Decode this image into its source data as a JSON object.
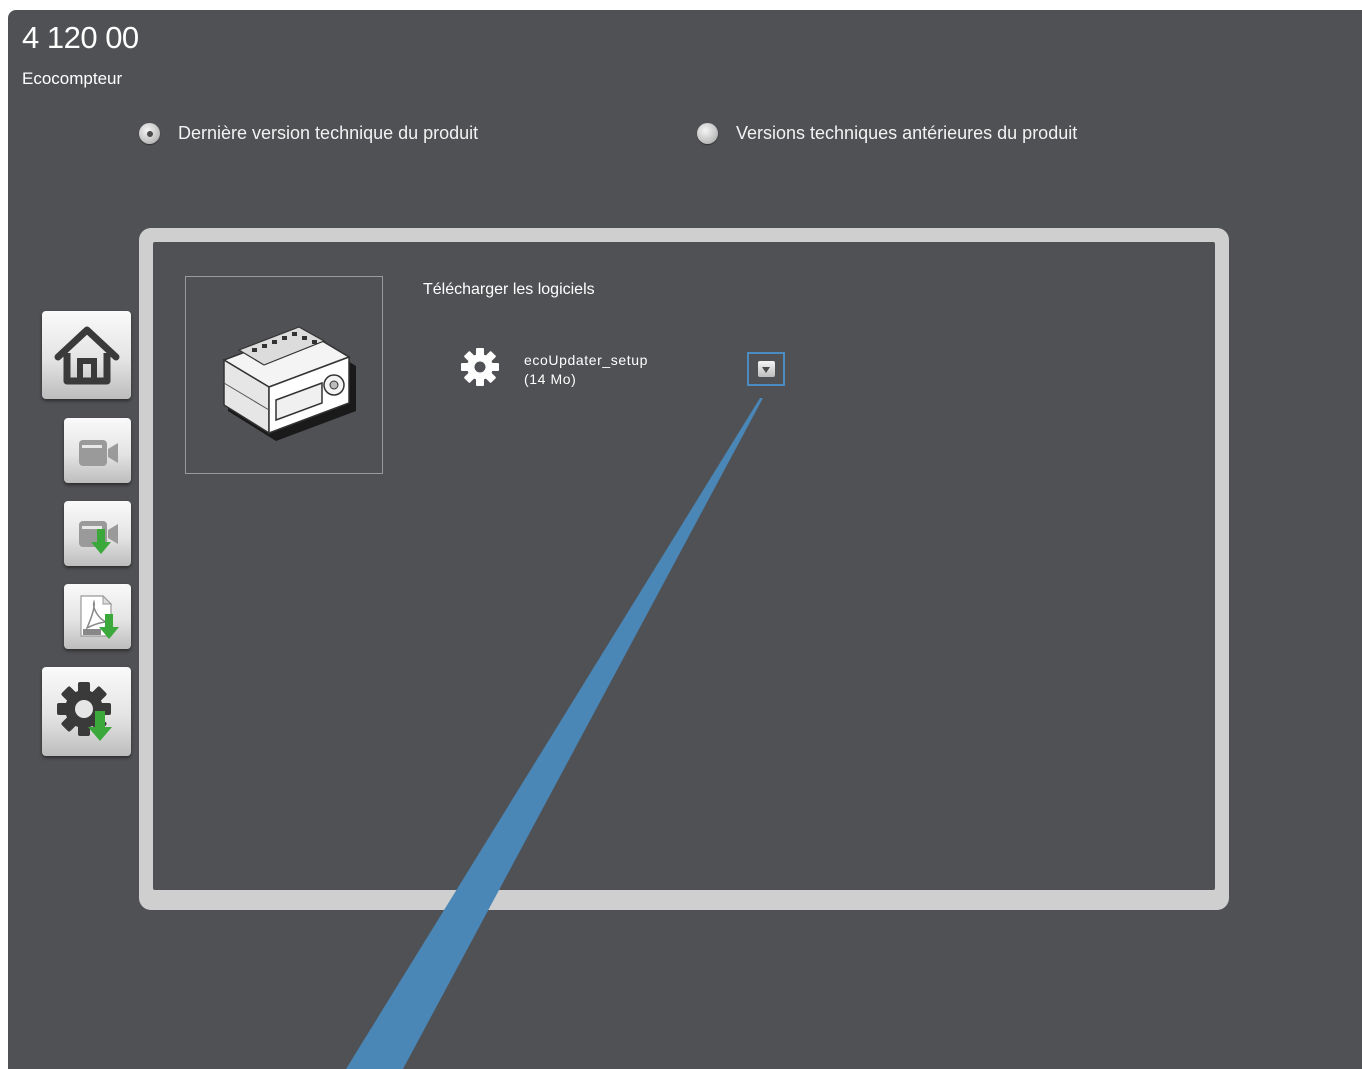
{
  "product": {
    "reference": "4 120 00",
    "name": "Ecocompteur"
  },
  "version_options": [
    {
      "label": "Dernière version technique du produit",
      "selected": true
    },
    {
      "label": "Versions techniques antérieures du produit",
      "selected": false
    }
  ],
  "downloads": {
    "title": "Télécharger les logiciels",
    "items": [
      {
        "name": "ecoUpdater_setup",
        "size": "(14 Mo)",
        "icon": "gear-icon"
      }
    ]
  },
  "sidebar": {
    "buttons": [
      {
        "name": "home-button",
        "icon": "home-icon"
      },
      {
        "name": "video-button",
        "icon": "video-camera-icon"
      },
      {
        "name": "video-download-button",
        "icon": "video-download-icon"
      },
      {
        "name": "pdf-download-button",
        "icon": "pdf-download-icon"
      },
      {
        "name": "software-download-button",
        "icon": "gear-download-icon"
      }
    ]
  },
  "colors": {
    "background": "#505154",
    "frame": "#cfcfcf",
    "accent": "#4a8bc2",
    "download_green": "#3aa83a"
  }
}
